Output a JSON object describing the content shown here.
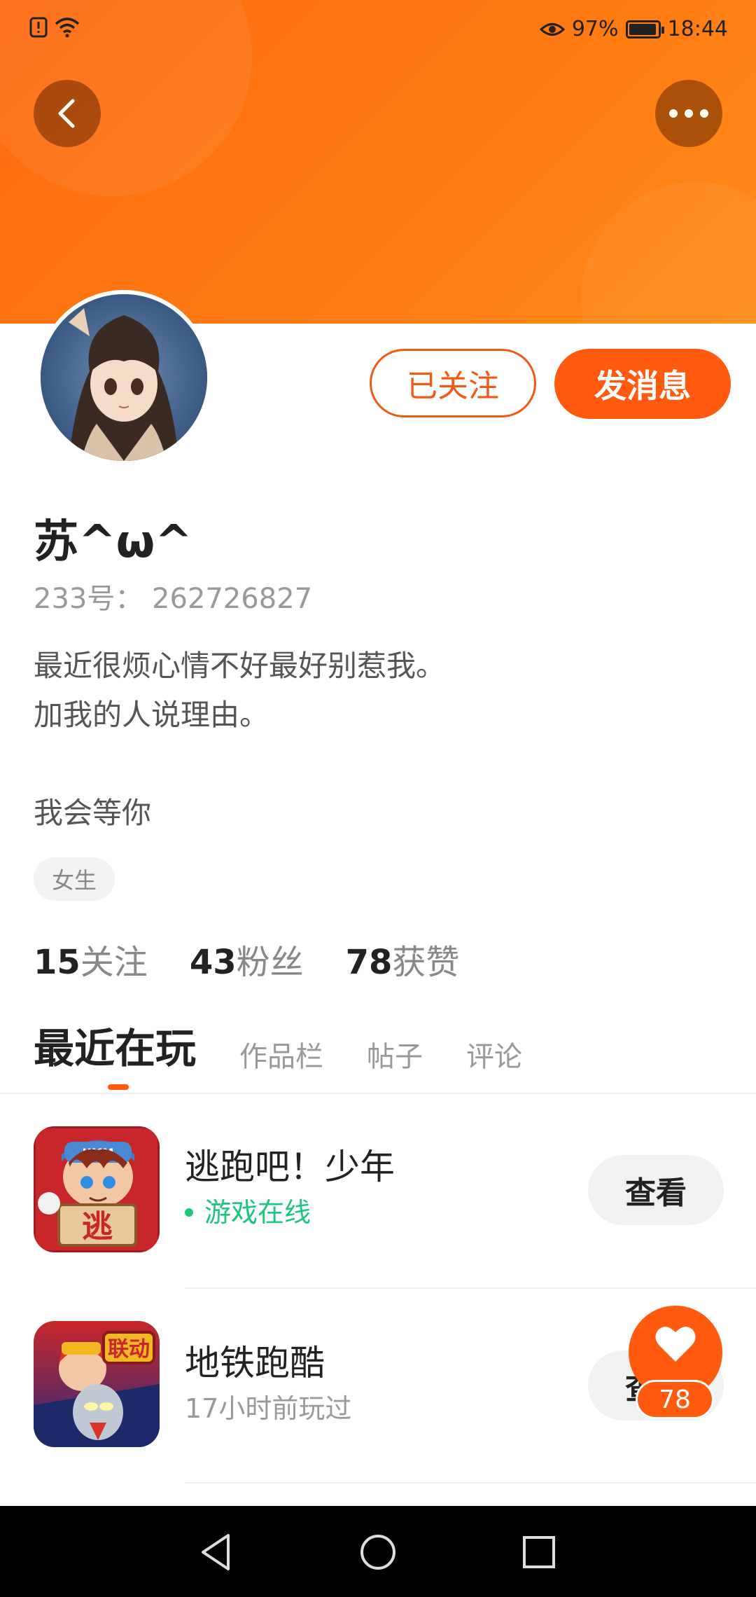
{
  "status_bar": {
    "battery_percent": "97%",
    "battery_level": 0.97,
    "time": "18:44"
  },
  "profile": {
    "name": "苏^ω^",
    "uid": "233号： 262726827",
    "bio": "最近很烦心情不好最好别惹我。\n加我的人说理由。\n\n我会等你",
    "tag": "女生",
    "follow_button": "已关注",
    "message_button": "发消息"
  },
  "stats": [
    {
      "num": "15",
      "label": "关注"
    },
    {
      "num": "43",
      "label": "粉丝"
    },
    {
      "num": "78",
      "label": "获赞"
    }
  ],
  "tabs": [
    {
      "label": "最近在玩",
      "active": true
    },
    {
      "label": "作品栏",
      "active": false
    },
    {
      "label": "帖子",
      "active": false
    },
    {
      "label": "评论",
      "active": false
    }
  ],
  "games": [
    {
      "name": "逃跑吧！少年",
      "status": "游戏在线",
      "status_type": "online",
      "view_label": "查看",
      "icon": "escape-game-icon",
      "icon_text": "逃",
      "icon_cap_text": "UMM"
    },
    {
      "name": "地铁跑酷",
      "status": "17小时前玩过",
      "status_type": "past",
      "view_label": "查看",
      "icon": "subway-surfers-icon",
      "icon_text": "联动"
    }
  ],
  "like_fab": {
    "count": "78"
  },
  "colors": {
    "accent": "#ff5a0e",
    "banner": "#ff7a12",
    "online": "#1ec57c"
  }
}
